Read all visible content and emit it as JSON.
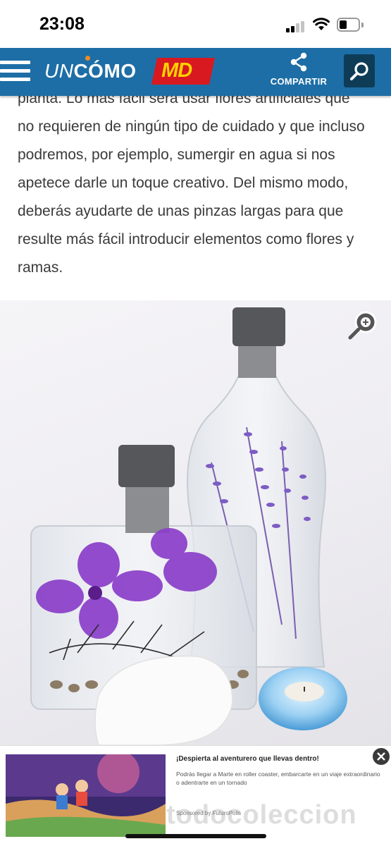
{
  "status_bar": {
    "time": "23:08"
  },
  "header": {
    "logo_un": "UN",
    "logo_como": "CÓMO",
    "partner_logo": "MD",
    "share_label": "COMPARTIR",
    "icons": [
      "menu-icon",
      "share-icon",
      "search-icon"
    ],
    "colors": {
      "bar": "#1d6ea6",
      "search_bg": "#0e3c57",
      "md_red": "#d81920",
      "md_yellow": "#ffd200"
    }
  },
  "article": {
    "partial_line": "planta. Lo más fácil será usar flores artificiales que",
    "paragraph": "no requieren de ningún tipo de cuidado y que incluso podremos, por ejemplo, sumergir en agua si nos apetece darle un toque creativo. Del mismo modo, deberás ayudarte de unas pinzas largas para que resulte más fácil introducir elementos como flores y ramas."
  },
  "image": {
    "zoom_icon": "zoom-in-icon"
  },
  "ad": {
    "title": "¡Despierta al aventurero que llevas dentro!",
    "text": "Podrás llegar a Marte en roller coaster, embarcarte en un viaje extraordinario o adentrarte en un tornado",
    "sponsor": "Sponsored by FuturoPolis"
  },
  "watermark": "todocoleccion"
}
